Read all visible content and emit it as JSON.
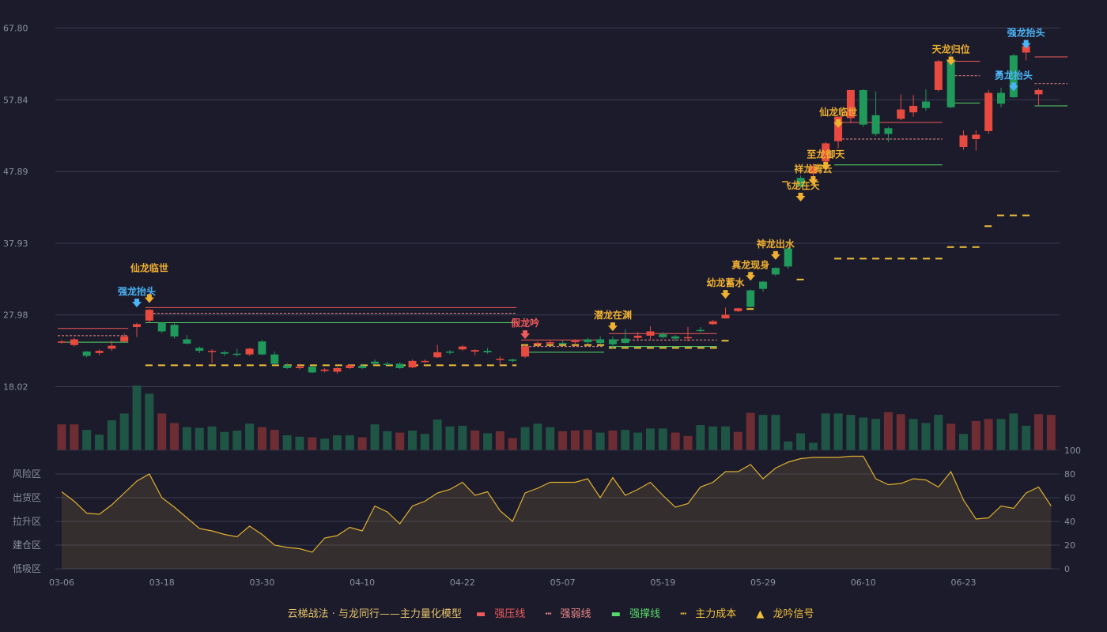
{
  "colors": {
    "up": "#e84a3f",
    "down": "#1f9a5a",
    "vol_up": "#6e2d33",
    "vol_down": "#1f5544",
    "pressure": "#f05a5a",
    "weak": "#f08a8a",
    "support": "#58d86a",
    "cost": "#f0c03a",
    "signal_up": "#f0b030",
    "signal_blue": "#4cb4f5",
    "signal_red": "#f05a5a",
    "osc": "#e0b030",
    "grid": "#3a3d52",
    "bg": "#1b1b2b"
  },
  "chart_data": {
    "type": "candlestick",
    "y_axis": {
      "ticks": [
        "67.80",
        "57.84",
        "47.89",
        "37.93",
        "27.98",
        "18.02"
      ],
      "range": [
        18.02,
        67.8
      ]
    },
    "x_ticks": [
      {
        "label": "03-06",
        "index": 0
      },
      {
        "label": "03-18",
        "index": 8
      },
      {
        "label": "03-30",
        "index": 16
      },
      {
        "label": "04-10",
        "index": 24
      },
      {
        "label": "04-22",
        "index": 32
      },
      {
        "label": "05-07",
        "index": 40
      },
      {
        "label": "05-19",
        "index": 48
      },
      {
        "label": "05-29",
        "index": 56
      },
      {
        "label": "06-10",
        "index": 64
      },
      {
        "label": "06-23",
        "index": 72
      }
    ],
    "candles": [
      [
        24.3,
        24.3,
        24.0,
        24.5
      ],
      [
        23.8,
        24.6,
        23.6,
        24.8
      ],
      [
        22.9,
        22.3,
        22.1,
        23.0
      ],
      [
        22.7,
        23.0,
        22.4,
        23.2
      ],
      [
        23.3,
        23.7,
        23.0,
        24.4
      ],
      [
        24.3,
        25.0,
        24.2,
        25.4
      ],
      [
        26.3,
        26.7,
        24.9,
        26.9
      ],
      [
        27.2,
        28.7,
        26.9,
        28.8
      ],
      [
        26.9,
        25.7,
        25.5,
        27.0
      ],
      [
        26.6,
        25.0,
        24.7,
        26.8
      ],
      [
        24.6,
        24.0,
        23.9,
        25.2
      ],
      [
        23.4,
        23.0,
        22.7,
        23.6
      ],
      [
        22.9,
        23.0,
        21.3,
        23.2
      ],
      [
        22.8,
        22.6,
        22.3,
        23.0
      ],
      [
        22.6,
        22.5,
        22.2,
        23.3
      ],
      [
        22.5,
        23.3,
        22.3,
        23.4
      ],
      [
        24.3,
        22.5,
        22.4,
        24.5
      ],
      [
        22.5,
        21.2,
        21.1,
        22.9
      ],
      [
        21.0,
        20.6,
        20.5,
        21.3
      ],
      [
        20.6,
        20.8,
        20.4,
        21.2
      ],
      [
        20.8,
        20.0,
        19.9,
        20.9
      ],
      [
        20.2,
        20.4,
        20.0,
        20.6
      ],
      [
        20.1,
        20.6,
        19.8,
        20.7
      ],
      [
        20.6,
        21.0,
        20.5,
        21.1
      ],
      [
        20.9,
        20.6,
        20.5,
        21.2
      ],
      [
        21.5,
        21.2,
        21.1,
        21.8
      ],
      [
        21.2,
        21.1,
        21.0,
        21.5
      ],
      [
        21.2,
        20.6,
        20.5,
        21.4
      ],
      [
        20.7,
        21.6,
        20.6,
        21.8
      ],
      [
        21.5,
        21.6,
        21.3,
        21.8
      ],
      [
        22.1,
        22.8,
        22.0,
        23.8
      ],
      [
        22.9,
        22.8,
        22.5,
        23.1
      ],
      [
        23.2,
        23.6,
        23.0,
        23.8
      ],
      [
        22.9,
        23.1,
        22.4,
        23.2
      ],
      [
        23.0,
        22.8,
        22.6,
        23.4
      ],
      [
        21.8,
        21.9,
        21.0,
        22.2
      ],
      [
        21.8,
        21.6,
        21.4,
        21.9
      ],
      [
        22.2,
        23.6,
        22.0,
        23.8
      ],
      [
        23.9,
        24.1,
        23.6,
        24.3
      ],
      [
        24.0,
        24.2,
        23.9,
        24.4
      ],
      [
        24.1,
        24.0,
        23.9,
        24.5
      ],
      [
        24.2,
        24.4,
        23.8,
        24.6
      ],
      [
        24.6,
        24.2,
        23.9,
        24.8
      ],
      [
        24.6,
        24.1,
        23.9,
        25.0
      ],
      [
        24.6,
        23.9,
        23.3,
        25.0
      ],
      [
        24.7,
        24.1,
        24.0,
        26.0
      ],
      [
        24.8,
        25.1,
        24.4,
        25.6
      ],
      [
        25.1,
        25.7,
        24.6,
        26.4
      ],
      [
        25.3,
        24.9,
        24.7,
        25.6
      ],
      [
        25.0,
        24.7,
        24.3,
        25.2
      ],
      [
        24.8,
        24.9,
        24.3,
        26.3
      ],
      [
        25.9,
        25.8,
        25.6,
        26.3
      ],
      [
        26.7,
        27.1,
        26.6,
        27.3
      ],
      [
        27.5,
        28.0,
        27.5,
        29.0
      ],
      [
        28.5,
        28.9,
        28.4,
        29.0
      ],
      [
        31.4,
        29.1,
        29.0,
        31.5
      ],
      [
        32.6,
        31.6,
        31.2,
        32.7
      ],
      [
        34.5,
        33.6,
        33.4,
        34.6
      ],
      [
        37.2,
        34.7,
        34.4,
        37.2
      ],
      [
        47.0,
        45.8,
        45.6,
        47.3
      ],
      [
        47.6,
        48.6,
        46.7,
        49.0
      ],
      [
        49.3,
        51.8,
        48.7,
        52.0
      ],
      [
        52.1,
        55.5,
        51.1,
        55.6
      ],
      [
        55.3,
        59.2,
        54.6,
        59.2
      ],
      [
        59.2,
        54.4,
        54.1,
        59.3
      ],
      [
        55.7,
        53.1,
        52.8,
        59.0
      ],
      [
        53.9,
        53.1,
        52.0,
        54.1
      ],
      [
        55.2,
        56.5,
        55.0,
        58.6
      ],
      [
        56.1,
        57.0,
        55.5,
        58.5
      ],
      [
        57.6,
        56.7,
        56.3,
        59.3
      ],
      [
        59.2,
        63.2,
        59.0,
        63.4
      ],
      [
        63.4,
        56.8,
        56.7,
        64.2
      ],
      [
        51.3,
        52.9,
        50.9,
        53.6
      ],
      [
        52.4,
        53.0,
        50.8,
        53.6
      ],
      [
        53.5,
        58.8,
        53.1,
        59.2
      ],
      [
        58.8,
        57.3,
        56.8,
        59.5
      ],
      [
        64.0,
        58.2,
        58.1,
        64.2
      ],
      [
        64.4,
        65.3,
        63.3,
        65.5
      ],
      [
        58.6,
        59.2,
        57.1,
        59.4
      ]
    ],
    "volumes": [
      38,
      38,
      30,
      23,
      44,
      54,
      95,
      83,
      54,
      40,
      34,
      33,
      35,
      27,
      29,
      39,
      34,
      30,
      22,
      20,
      19,
      17,
      22,
      22,
      19,
      38,
      28,
      26,
      29,
      24,
      45,
      35,
      36,
      29,
      25,
      28,
      18,
      34,
      39,
      34,
      28,
      29,
      30,
      26,
      29,
      30,
      26,
      32,
      32,
      26,
      21,
      37,
      35,
      35,
      27,
      55,
      52,
      52,
      13,
      25,
      11,
      54,
      54,
      52,
      48,
      46,
      56,
      53,
      46,
      40,
      52,
      39,
      24,
      43,
      46,
      46,
      54,
      36,
      53,
      52
    ],
    "vol_up": [
      true,
      true,
      false,
      false,
      false,
      false,
      false,
      false,
      true,
      true,
      false,
      false,
      false,
      false,
      false,
      false,
      true,
      true,
      false,
      false,
      true,
      false,
      false,
      false,
      true,
      false,
      false,
      true,
      false,
      false,
      false,
      false,
      false,
      true,
      false,
      true,
      true,
      false,
      false,
      false,
      true,
      true,
      true,
      false,
      true,
      false,
      false,
      false,
      false,
      true,
      true,
      false,
      false,
      false,
      true,
      true,
      false,
      false,
      false,
      false,
      false,
      false,
      false,
      false,
      false,
      false,
      true,
      true,
      false,
      false,
      false,
      true,
      false,
      true,
      true,
      false,
      false,
      false,
      true,
      true
    ],
    "oscillator": [
      65,
      57,
      47,
      46,
      54,
      64,
      74,
      80,
      60,
      52,
      43,
      34,
      32,
      29,
      27,
      36,
      29,
      20,
      18,
      17,
      14,
      26,
      28,
      35,
      32,
      53,
      48,
      38,
      53,
      57,
      64,
      67,
      73,
      62,
      65,
      49,
      40,
      64,
      68,
      73,
      73,
      73,
      76,
      60,
      77,
      62,
      67,
      73,
      62,
      52,
      55,
      69,
      73,
      82,
      82,
      88,
      76,
      85,
      90,
      93,
      94,
      94,
      94,
      95,
      95,
      76,
      71,
      72,
      76,
      75,
      69,
      82,
      58,
      42,
      43,
      53,
      51,
      64,
      69,
      53
    ],
    "osc_zones": [
      {
        "label": "风险区",
        "color": "#e6a030"
      },
      {
        "label": "出货区",
        "color": "#d050c8"
      },
      {
        "label": "拉升区",
        "color": "#4b8cf0"
      },
      {
        "label": "建仓区",
        "color": "#e04050"
      },
      {
        "label": "低吸区",
        "color": "#e04050"
      }
    ],
    "osc_ticks": [
      "100",
      "80",
      "60",
      "40",
      "20",
      "0"
    ],
    "signals": [
      {
        "label": "强龙抬头",
        "index": 6,
        "price": 28.6,
        "color": "blue"
      },
      {
        "label": "仙龙临世",
        "index": 7,
        "price": 29.2,
        "color": "up",
        "offset": 2
      },
      {
        "label": "假龙吟",
        "index": 37,
        "price": 24.2,
        "color": "red"
      },
      {
        "label": "潜龙在渊",
        "index": 44,
        "price": 25.3,
        "color": "up"
      },
      {
        "label": "幼龙蓄水",
        "index": 53,
        "price": 29.8,
        "color": "up"
      },
      {
        "label": "真龙现身",
        "index": 55,
        "price": 32.3,
        "color": "up"
      },
      {
        "label": "神龙出水",
        "index": 57,
        "price": 35.2,
        "color": "up"
      },
      {
        "label": "飞龙在天",
        "index": 59,
        "price": 43.3,
        "color": "up"
      },
      {
        "label": "祥龙腾云",
        "index": 60,
        "price": 45.6,
        "color": "up"
      },
      {
        "label": "至龙御天",
        "index": 61,
        "price": 47.6,
        "color": "up"
      },
      {
        "label": "仙龙临世",
        "index": 62,
        "price": 53.5,
        "color": "up"
      },
      {
        "label": "天龙归位",
        "index": 71,
        "price": 62.2,
        "color": "up"
      },
      {
        "label": "勇龙抬头",
        "index": 76,
        "price": 58.6,
        "color": "blue"
      },
      {
        "label": "强龙抬头",
        "index": 77,
        "price": 64.5,
        "color": "blue"
      }
    ],
    "lines": [
      {
        "type": "pressure",
        "segments": [
          [
            0,
            5,
            26.1
          ],
          [
            7,
            36,
            29.0
          ]
        ]
      },
      {
        "type": "weak",
        "segments": [
          [
            0,
            5,
            25.1
          ],
          [
            7,
            36,
            28.2
          ]
        ]
      },
      {
        "type": "support",
        "segments": [
          [
            0,
            5,
            24.2
          ],
          [
            7,
            36,
            26.9
          ]
        ]
      },
      {
        "type": "pressure",
        "segments": [
          [
            37,
            43,
            24.5
          ],
          [
            44,
            52,
            25.4
          ],
          [
            62,
            70,
            54.7
          ],
          [
            71,
            73,
            63.2
          ],
          [
            78,
            80,
            63.8
          ]
        ]
      },
      {
        "type": "weak",
        "segments": [
          [
            37,
            43,
            23.6
          ],
          [
            44,
            52,
            24.5
          ],
          [
            62,
            70,
            52.4
          ],
          [
            71,
            73,
            61.2
          ],
          [
            78,
            80,
            60.1
          ]
        ]
      },
      {
        "type": "support",
        "segments": [
          [
            37,
            43,
            22.8
          ],
          [
            44,
            52,
            23.6
          ],
          [
            62,
            70,
            48.8
          ],
          [
            71,
            73,
            57.4
          ],
          [
            78,
            80,
            57.0
          ]
        ]
      },
      {
        "type": "cost",
        "segments": [
          [
            7,
            36,
            21.0
          ],
          [
            37,
            43,
            23.8
          ],
          [
            44,
            52,
            23.4
          ],
          [
            53,
            53,
            24.4
          ],
          [
            55,
            55,
            28.8
          ],
          [
            59,
            59,
            32.9
          ],
          [
            62,
            70,
            35.8
          ],
          [
            71,
            73,
            37.4
          ],
          [
            74,
            74,
            40.3
          ],
          [
            75,
            77,
            41.8
          ]
        ]
      }
    ]
  },
  "legend": {
    "title": "云梯战法 · 与龙同行——主力量化模型",
    "pressure": "强压线",
    "weak": "强弱线",
    "support": "强撑线",
    "cost": "主力成本",
    "signal": "龙吟信号"
  }
}
